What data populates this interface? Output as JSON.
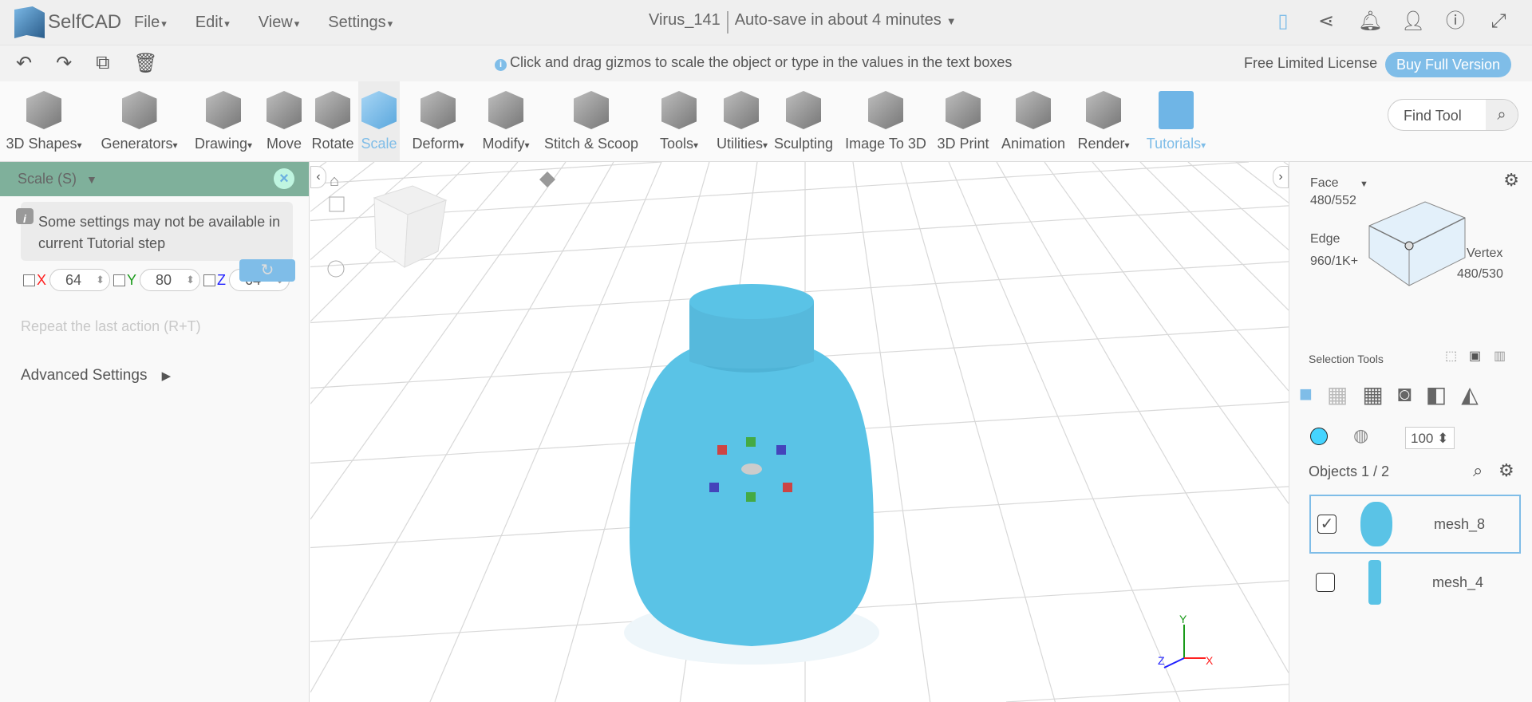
{
  "app": {
    "name": "SelfCAD"
  },
  "menu": [
    "File",
    "Edit",
    "View",
    "Settings"
  ],
  "doc": {
    "title": "Virus_141",
    "autosave": "Auto-save in about 4 minutes"
  },
  "top_icons": [
    "save-icon",
    "share-icon",
    "bell-icon",
    "user-icon",
    "info-icon",
    "fullscreen-icon"
  ],
  "hint": "Click and drag gizmos to scale the object or type in the values in the text boxes",
  "license": "Free Limited License",
  "buy": "Buy Full Version",
  "tools": [
    {
      "label": "3D Shapes",
      "dd": true
    },
    {
      "label": "Generators",
      "dd": true
    },
    {
      "label": "Drawing",
      "dd": true
    },
    {
      "label": "Move"
    },
    {
      "label": "Rotate"
    },
    {
      "label": "Scale",
      "active": true
    },
    {
      "label": "Deform",
      "dd": true
    },
    {
      "label": "Modify",
      "dd": true
    },
    {
      "label": "Stitch & Scoop"
    },
    {
      "label": "Tools",
      "dd": true
    },
    {
      "label": "Utilities",
      "dd": true
    },
    {
      "label": "Sculpting"
    },
    {
      "label": "Image To 3D"
    },
    {
      "label": "3D Print"
    },
    {
      "label": "Animation"
    },
    {
      "label": "Render",
      "dd": true
    },
    {
      "label": "Tutorials",
      "dd": true
    }
  ],
  "find_tool": "Find Tool",
  "panel": {
    "title": "Scale (S)",
    "note": "Some settings may not be available in current Tutorial step",
    "x_label": "X",
    "y_label": "Y",
    "z_label": "Z",
    "x": "64",
    "y": "80",
    "z": "64",
    "repeat": "Repeat the last action (R+T)",
    "advanced": "Advanced Settings"
  },
  "colors": {
    "x": "#ff2020",
    "y": "#1a9a1a",
    "z": "#2020ff",
    "accent": "#7fbde8",
    "mesh": "#5ac3e6",
    "panel_header": "#7fb09b"
  },
  "right": {
    "face_label": "Face",
    "face_count": "480/552",
    "edge_label": "Edge",
    "edge_count": "960/1K+",
    "vertex_label": "Vertex",
    "vertex_count": "480/530",
    "selection_tools": "Selection Tools",
    "opacity": "100",
    "objects": "Objects 1 / 2",
    "items": [
      {
        "name": "mesh_8",
        "checked": "✓"
      },
      {
        "name": "mesh_4",
        "checked": ""
      }
    ]
  },
  "axes": {
    "x": "X",
    "y": "Y",
    "z": "Z"
  }
}
